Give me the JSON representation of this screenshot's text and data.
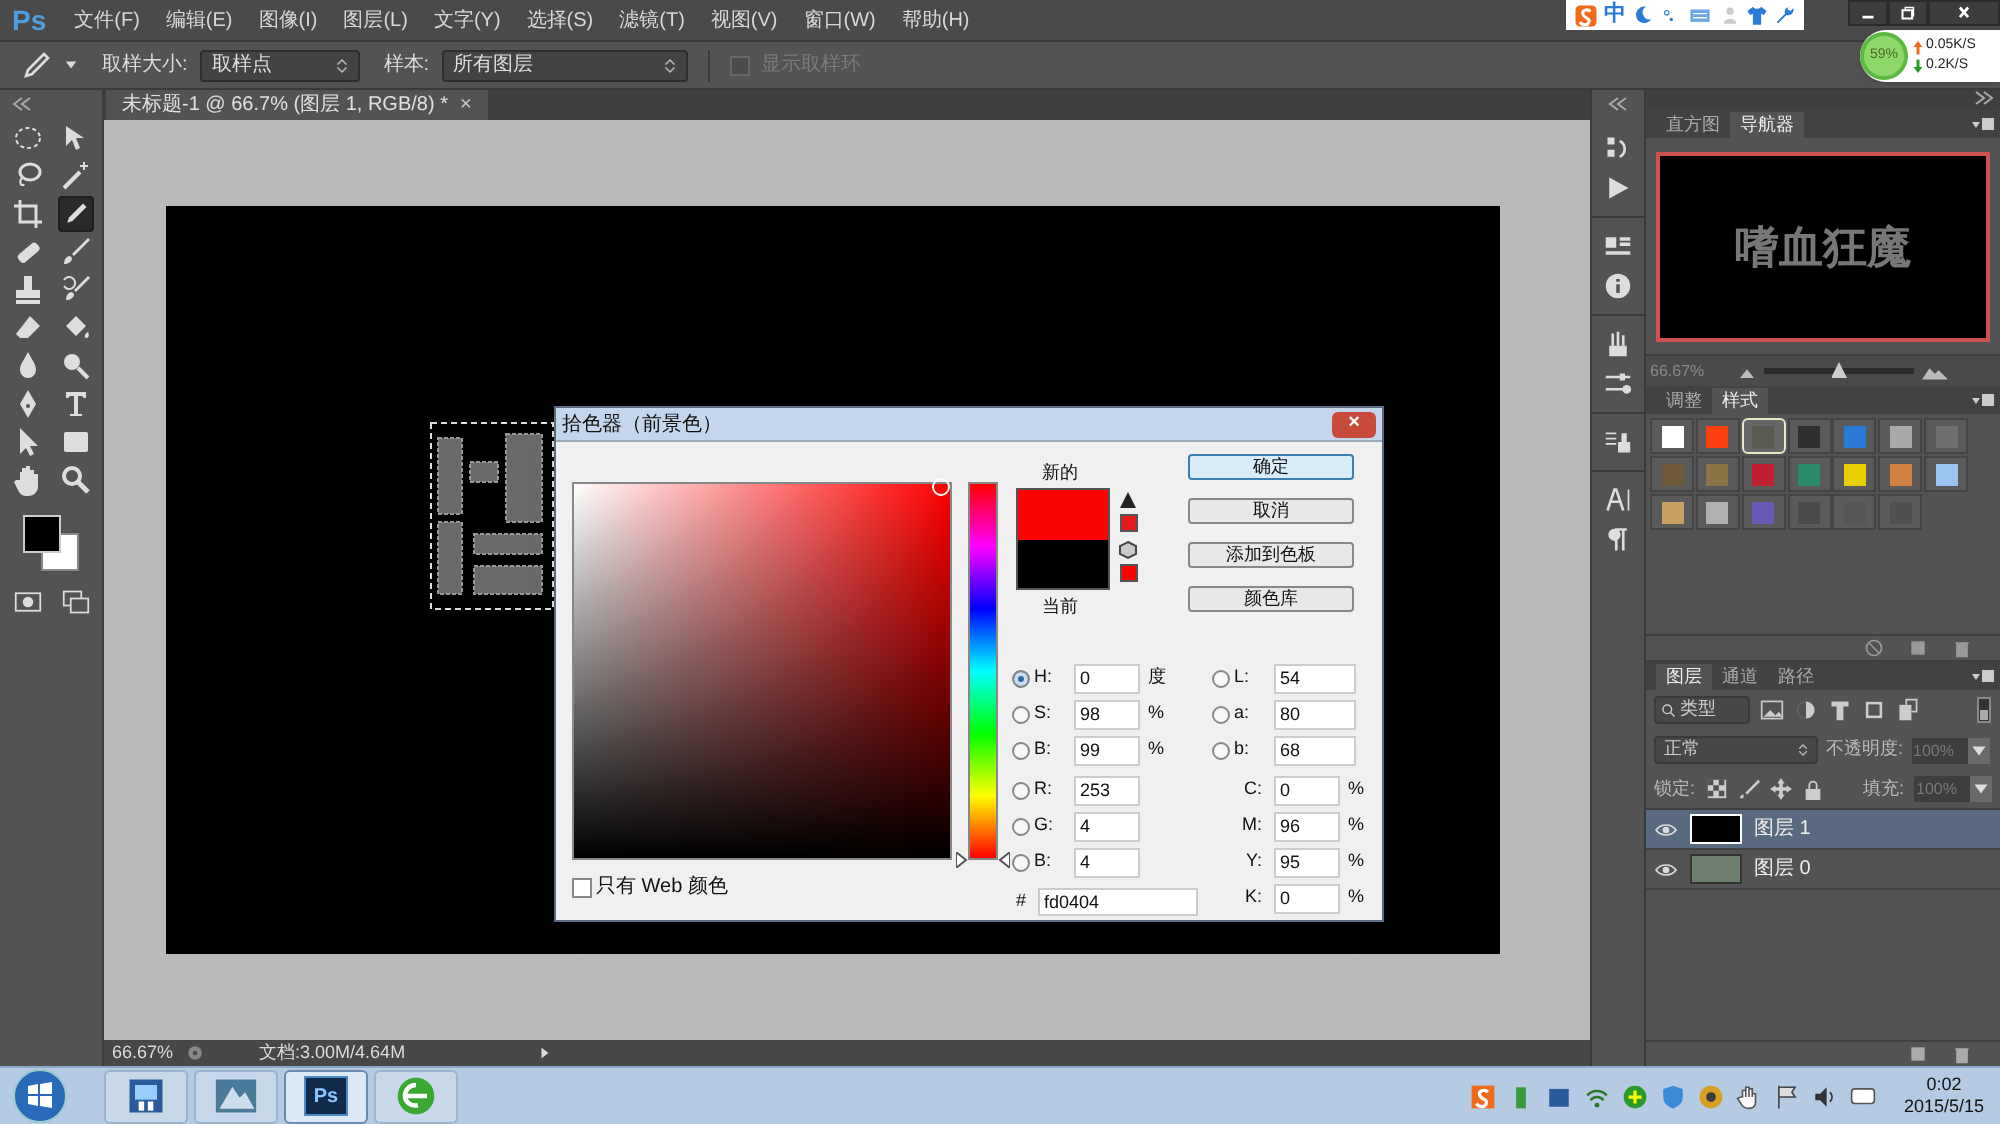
{
  "menu_bar": {
    "logo": "Ps",
    "items": [
      "文件(F)",
      "编辑(E)",
      "图像(I)",
      "图层(L)",
      "文字(Y)",
      "选择(S)",
      "滤镜(T)",
      "视图(V)",
      "窗口(W)",
      "帮助(H)"
    ]
  },
  "ime_bar": {
    "mode": "中"
  },
  "network_widget": {
    "usage": "59%",
    "upload": "0.05K/S",
    "download": "0.2K/S"
  },
  "options_bar": {
    "sample_size": {
      "label": "取样大小:",
      "value": "取样点"
    },
    "sample": {
      "label": "样本:",
      "value": "所有图层"
    },
    "show_ring": {
      "label": "显示取样环",
      "checked": false,
      "disabled": true
    }
  },
  "document_tab": {
    "title": "未标题-1 @ 66.7% (图层 1, RGB/8) *",
    "close": "×"
  },
  "tools": [
    {
      "kind": "marquee",
      "selected": false
    },
    {
      "kind": "move",
      "selected": false
    },
    {
      "kind": "lasso",
      "selected": false
    },
    {
      "kind": "wand",
      "selected": false
    },
    {
      "kind": "crop",
      "selected": false
    },
    {
      "kind": "eyedropper",
      "selected": true
    },
    {
      "kind": "bandage",
      "selected": false
    },
    {
      "kind": "brush",
      "selected": false
    },
    {
      "kind": "stamp",
      "selected": false
    },
    {
      "kind": "history",
      "selected": false
    },
    {
      "kind": "eraser",
      "selected": false
    },
    {
      "kind": "bucket",
      "selected": false
    },
    {
      "kind": "drop",
      "selected": false
    },
    {
      "kind": "dodge",
      "selected": false
    },
    {
      "kind": "pen",
      "selected": false
    },
    {
      "kind": "type",
      "selected": false
    },
    {
      "kind": "pointer",
      "selected": false
    },
    {
      "kind": "rect",
      "selected": false
    },
    {
      "kind": "hand",
      "selected": false
    },
    {
      "kind": "zoom",
      "selected": false
    }
  ],
  "navigator": {
    "tabs": [
      {
        "label": "直方图",
        "selected": false
      },
      {
        "label": "导航器",
        "selected": true
      }
    ],
    "preview_text": "嗜血狂魔",
    "zoom": "66.67%",
    "zoom_slider": {
      "level": 0.5
    }
  },
  "styles_panel": {
    "tabs": [
      {
        "label": "调整",
        "selected": false
      },
      {
        "label": "样式",
        "selected": true
      }
    ],
    "swatches": [
      {
        "color": "#ffffff",
        "selected": false
      },
      {
        "color": "#ff4010",
        "selected": false
      },
      {
        "color": "#5a5a50",
        "selected": true
      },
      {
        "color": "#303030",
        "selected": false
      },
      {
        "color": "#2a7ad8",
        "selected": false
      },
      {
        "color": "#a8a8a8",
        "selected": false
      },
      {
        "color": "#707070",
        "selected": false
      },
      {
        "color": "#6e5a38",
        "selected": false
      },
      {
        "color": "#8a7448",
        "selected": false
      },
      {
        "color": "#c02030",
        "selected": false
      },
      {
        "color": "#2a8a6a",
        "selected": false
      },
      {
        "color": "#e8d000",
        "selected": false
      },
      {
        "color": "#d08040",
        "selected": false
      },
      {
        "color": "#9cc4f0",
        "selected": false
      },
      {
        "color": "#c8a060",
        "selected": false
      },
      {
        "color": "#b0b0b0",
        "selected": false
      },
      {
        "color": "#6a5ab8",
        "selected": false
      },
      {
        "color": "#4a4a4a",
        "selected": false
      },
      {
        "color": "#555555",
        "selected": false
      },
      {
        "color": "#505050",
        "selected": false
      }
    ]
  },
  "layers_panel": {
    "tabs": [
      {
        "label": "图层",
        "selected": true
      },
      {
        "label": "通道",
        "selected": false
      },
      {
        "label": "路径",
        "selected": false
      }
    ],
    "filter": "类型",
    "blend_mode": "正常",
    "opacity_label": "不透明度:",
    "opacity": "100%",
    "lock_label": "锁定:",
    "fill_label": "填充:",
    "fill": "100%",
    "layers": [
      {
        "name": "图层 1",
        "selected": true,
        "visible": true,
        "color": "#000000"
      },
      {
        "name": "图层 0",
        "selected": false,
        "visible": true,
        "color": "#6e7e6e"
      }
    ]
  },
  "color_picker": {
    "title": "拾色器（前景色）",
    "close": "×",
    "new_label": "新的",
    "current_label": "当前",
    "buttons": [
      {
        "label": "确定",
        "default": true
      },
      {
        "label": "取消",
        "default": false
      },
      {
        "label": "添加到色板",
        "default": false
      },
      {
        "label": "颜色库",
        "default": false
      }
    ],
    "left_fields": [
      {
        "kind": "radio",
        "label": "H:",
        "value": "0",
        "unit": "度",
        "selected": true
      },
      {
        "kind": "radio",
        "label": "S:",
        "value": "98",
        "unit": "%",
        "selected": false
      },
      {
        "kind": "radio",
        "label": "B:",
        "value": "99",
        "unit": "%",
        "selected": false
      },
      {
        "kind": "radio",
        "label": "R:",
        "value": "253",
        "selected": false
      },
      {
        "kind": "radio",
        "label": "G:",
        "value": "4",
        "selected": false
      },
      {
        "kind": "radio",
        "label": "B:",
        "value": "4",
        "selected": false
      }
    ],
    "right_fields": [
      {
        "kind": "radio",
        "label": "L:",
        "value": "54",
        "selected": false
      },
      {
        "kind": "radio",
        "label": "a:",
        "value": "80",
        "selected": false
      },
      {
        "kind": "radio",
        "label": "b:",
        "value": "68",
        "selected": false
      },
      {
        "kind": "plain",
        "label": "C:",
        "value": "0",
        "unit": "%"
      },
      {
        "kind": "plain",
        "label": "M:",
        "value": "96",
        "unit": "%"
      },
      {
        "kind": "plain",
        "label": "Y:",
        "value": "95",
        "unit": "%"
      },
      {
        "kind": "plain",
        "label": "K:",
        "value": "0",
        "unit": "%"
      }
    ],
    "hex_label": "#",
    "hex": "fd0404",
    "web_only": {
      "label": "只有 Web 颜色",
      "checked": false
    }
  },
  "status_bar": {
    "zoom": "66.67%",
    "document": "文档:3.00M/4.64M"
  },
  "taskbar": {
    "apps": [
      {
        "kind": "media",
        "selected": false
      },
      {
        "kind": "photo",
        "selected": false
      },
      {
        "kind": "photoshop",
        "label": "Ps",
        "selected": true
      },
      {
        "kind": "browser",
        "selected": false
      }
    ],
    "time": "0:02",
    "date": "2015/5/15"
  }
}
